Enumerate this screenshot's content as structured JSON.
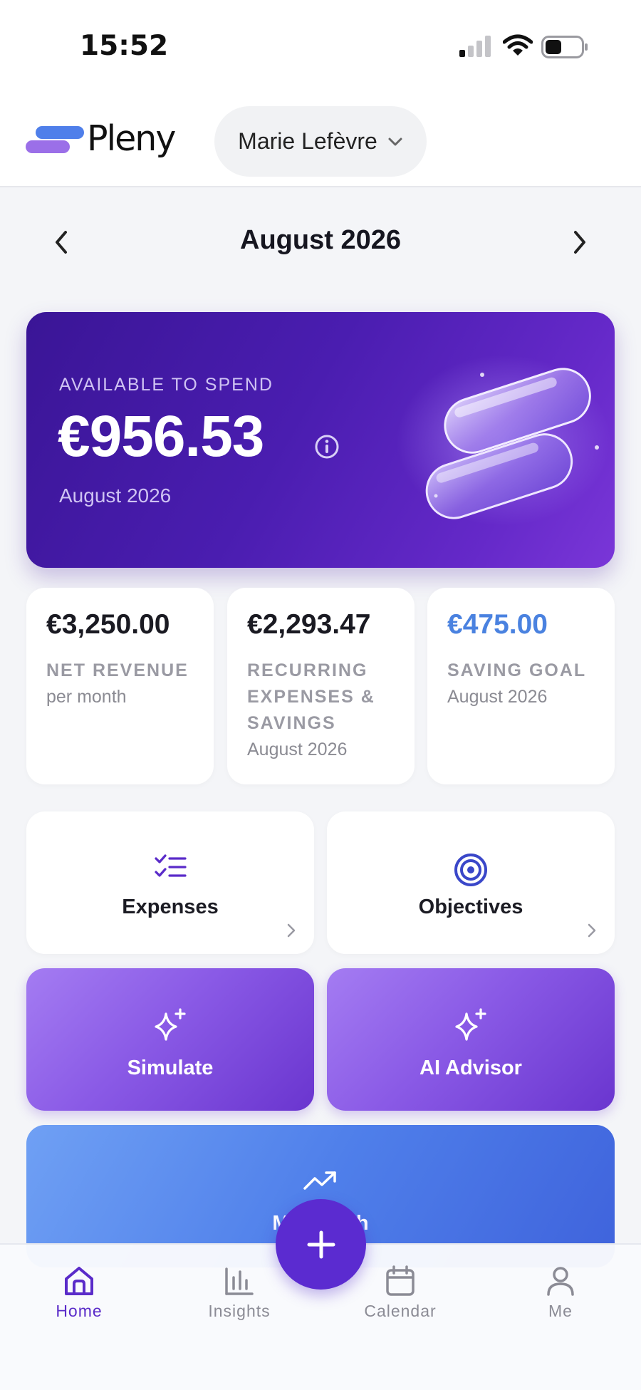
{
  "status_bar": {
    "time": "15:52"
  },
  "header": {
    "brand": "Pleny",
    "profile_name": "Marie Lefèvre"
  },
  "month_nav": {
    "title": "August 2026"
  },
  "hero": {
    "label": "AVAILABLE TO SPEND",
    "amount": "€956.53",
    "period": "August 2026"
  },
  "stats": [
    {
      "value": "€3,250.00",
      "label": "NET REVENUE",
      "sub": "per month",
      "value_color": "#1a1a22"
    },
    {
      "value": "€2,293.47",
      "label": "RECURRING EXPENSES & SAVINGS",
      "sub": "August 2026",
      "value_color": "#1a1a22"
    },
    {
      "value": "€475.00",
      "label": "SAVING GOAL",
      "sub": "August 2026",
      "value_color": "#4a82e0"
    }
  ],
  "tiles": {
    "expenses": {
      "label": "Expenses",
      "icon": "checklist-icon"
    },
    "objectives": {
      "label": "Objectives",
      "icon": "target-icon"
    },
    "simulate": {
      "label": "Simulate",
      "icon": "sparkles-icon"
    },
    "ai_advisor": {
      "label": "AI Advisor",
      "icon": "sparkles-icon"
    },
    "wide": {
      "label": "My Month",
      "icon": "trending-up-icon"
    }
  },
  "bottom_nav": {
    "items": [
      {
        "label": "Home",
        "icon": "home-icon",
        "active": true
      },
      {
        "label": "Insights",
        "icon": "bar-chart-icon",
        "active": false
      },
      {
        "label": "Calendar",
        "icon": "calendar-icon",
        "active": false
      },
      {
        "label": "Me",
        "icon": "user-icon",
        "active": false
      }
    ],
    "fab_icon": "plus-icon"
  },
  "colors": {
    "accent": "#5b2bd0",
    "hero_gradient_start": "#3a1596",
    "hero_gradient_end": "#7a36d8",
    "tile_purple": "#8a5ae6",
    "tile_blue": "#4f7fea",
    "saving_goal": "#4a82e0"
  }
}
